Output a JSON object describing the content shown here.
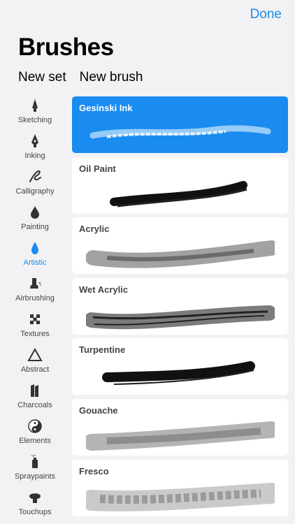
{
  "header": {
    "done_label": "Done",
    "title": "Brushes"
  },
  "actions": {
    "new_set": "New set",
    "new_brush": "New brush"
  },
  "categories": [
    {
      "label": "Sketching",
      "icon": "pencil-tip-icon"
    },
    {
      "label": "Inking",
      "icon": "pen-nib-icon"
    },
    {
      "label": "Calligraphy",
      "icon": "calligraphy-icon"
    },
    {
      "label": "Painting",
      "icon": "paint-drop-icon"
    },
    {
      "label": "Artistic",
      "icon": "artistic-drop-icon",
      "active": true
    },
    {
      "label": "Airbrushing",
      "icon": "airbrush-icon"
    },
    {
      "label": "Textures",
      "icon": "checker-icon"
    },
    {
      "label": "Abstract",
      "icon": "triangle-icon"
    },
    {
      "label": "Charcoals",
      "icon": "charcoal-icon"
    },
    {
      "label": "Elements",
      "icon": "yin-yang-icon"
    },
    {
      "label": "Spraypaints",
      "icon": "spray-can-icon"
    },
    {
      "label": "Touchups",
      "icon": "touchup-icon"
    }
  ],
  "brushes": [
    {
      "name": "Gesinski Ink",
      "selected": true
    },
    {
      "name": "Oil Paint"
    },
    {
      "name": "Acrylic"
    },
    {
      "name": "Wet Acrylic"
    },
    {
      "name": "Turpentine"
    },
    {
      "name": "Gouache"
    },
    {
      "name": "Fresco"
    }
  ],
  "colors": {
    "accent": "#1a8cf0",
    "background": "#f2f2f4"
  }
}
